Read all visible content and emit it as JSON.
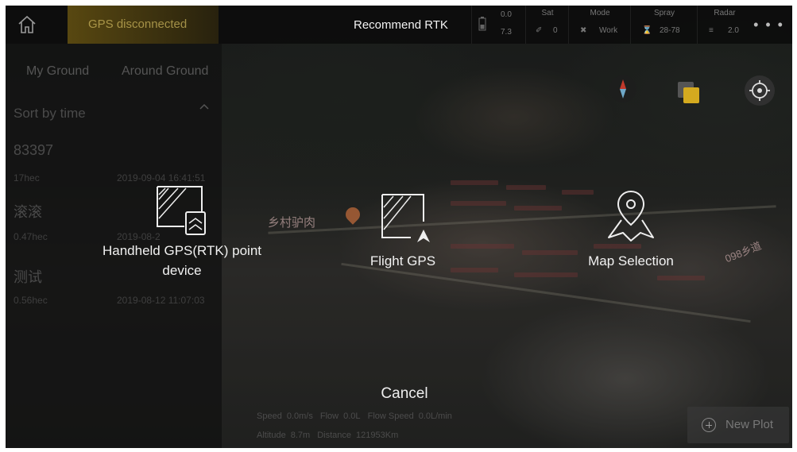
{
  "topbar": {
    "gps_status": "GPS disconnected",
    "recommend": "Recommend RTK",
    "battery": {
      "top": "0.0",
      "bottom": "7.3"
    },
    "sat": {
      "label": "Sat",
      "value": "0"
    },
    "mode": {
      "label": "Mode",
      "value": "Work"
    },
    "spray": {
      "label": "Spray",
      "value": "28-78"
    },
    "radar": {
      "label": "Radar",
      "value": "2.0"
    },
    "more": "• • •"
  },
  "left_panel": {
    "tabs": [
      "My Ground",
      "Around Ground"
    ],
    "sort_label": "Sort by time",
    "plots": [
      {
        "name": "83397",
        "area": "17hec",
        "date": "2019-09-04 16:41:51"
      },
      {
        "name": "滚滚",
        "area": "0.47hec",
        "date": "2019-08-2"
      },
      {
        "name": "测试",
        "area": "0.56hec",
        "date": "2019-08-12 11:07:03"
      }
    ]
  },
  "map": {
    "place_1": "乡村驴肉",
    "place_2": "098乡道"
  },
  "chooser": {
    "options": [
      {
        "label": "Handheld GPS(RTK) point device",
        "icon": "handheld-device-icon"
      },
      {
        "label": "Flight GPS",
        "icon": "flight-gps-icon"
      },
      {
        "label": "Map Selection",
        "icon": "map-pin-icon"
      }
    ],
    "cancel": "Cancel"
  },
  "telemetry": {
    "speed_label": "Speed",
    "speed": "0.0m/s",
    "flow_label": "Flow",
    "flow": "0.0L",
    "flow_speed_label": "Flow Speed",
    "flow_speed": "0.0L/min",
    "altitude_label": "Altitude",
    "altitude": "8.7m",
    "distance_label": "Distance",
    "distance": "121953Km"
  },
  "new_plot": "New Plot",
  "colors": {
    "accent": "#e0b323",
    "text": "#f1f1f1"
  }
}
